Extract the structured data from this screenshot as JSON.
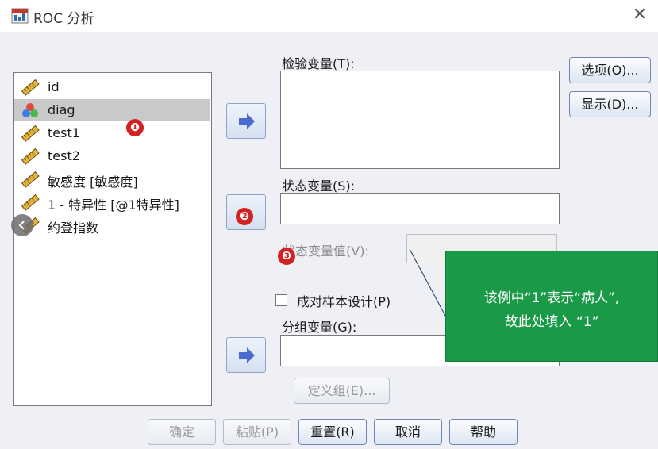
{
  "window": {
    "title": "ROC 分析",
    "icon": "roc-chart-icon",
    "close_icon": "close-icon"
  },
  "variables": [
    {
      "label": "id",
      "icon": "ruler-scale-icon"
    },
    {
      "label": "diag",
      "icon": "nominal-circles-icon",
      "selected": true
    },
    {
      "label": "test1",
      "icon": "ruler-scale-icon"
    },
    {
      "label": "test2",
      "icon": "ruler-scale-icon"
    },
    {
      "label": "敏感度  [敏感度]",
      "icon": "ruler-scale-icon"
    },
    {
      "label": "1 - 特异性 [@1特异性]",
      "icon": "ruler-scale-icon"
    },
    {
      "label": "约登指数",
      "icon": "ruler-scale-icon"
    }
  ],
  "fields": {
    "test_var": {
      "label": "检验变量(T):",
      "value": ""
    },
    "state_var": {
      "label": "状态变量(S):",
      "value": ""
    },
    "state_value": {
      "label": "状态变量值(V):",
      "value": ""
    },
    "paired": {
      "label": "成对样本设计(P)",
      "checked": false
    },
    "group_var": {
      "label": "分组变量(G):",
      "value": ""
    }
  },
  "buttons": {
    "options": "选项(O)...",
    "display": "显示(D)...",
    "define_groups": "定义组(E)...",
    "ok": "确定",
    "paste": "粘贴(P)",
    "reset": "重置(R)",
    "cancel": "取消",
    "help": "帮助"
  },
  "annotations": {
    "badges": [
      "❶",
      "❷",
      "❸"
    ],
    "callout_line1": "该例中“1”表示“病人”,",
    "callout_line2": "故此处填入 “1”"
  },
  "colors": {
    "callout_bg": "#1a9a47",
    "badge": "#d42121",
    "selection": "#c9c9c9",
    "arrow": "#4c6bd1"
  }
}
